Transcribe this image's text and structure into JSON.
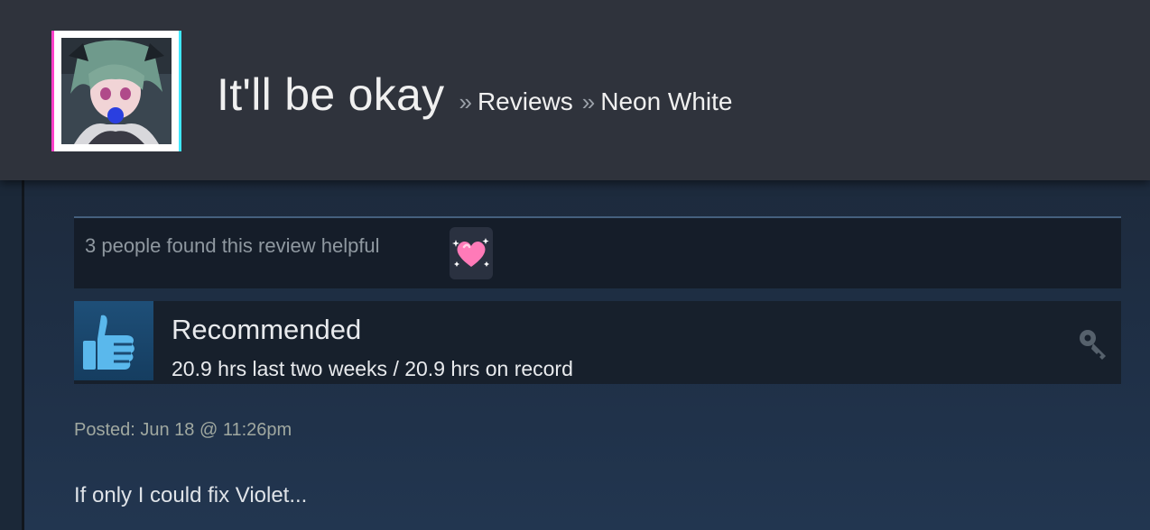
{
  "header": {
    "user_name": "It'll be okay",
    "breadcrumb_separator": "»",
    "breadcrumbs": [
      "Reviews",
      "Neon White"
    ]
  },
  "review": {
    "helpful_text": "3 people found this review helpful",
    "award_icon": "sparkle-heart-icon",
    "recommendation": "Recommended",
    "hours": "20.9 hrs last two weeks / 20.9 hrs on record",
    "thumb_icon": "thumbs-up-icon",
    "key_icon": "key-icon",
    "posted": "Posted: Jun 18 @ 11:26pm",
    "text": "If only I could fix Violet..."
  },
  "colors": {
    "header_bg": "#2f333c",
    "panel_bg": "#1d2a3c",
    "thumb_blue": "#5ab8ec",
    "heart_pink": "#ff7ab8"
  }
}
